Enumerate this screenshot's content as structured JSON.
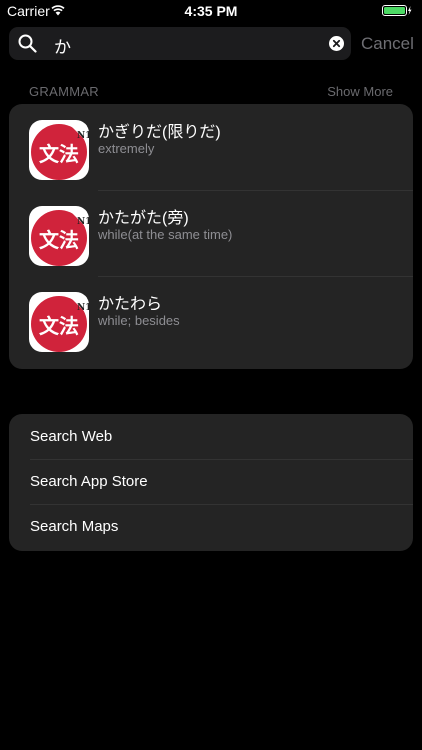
{
  "status_bar": {
    "carrier": "Carrier",
    "time": "4:35 PM"
  },
  "search": {
    "query": "か",
    "cancel_label": "Cancel"
  },
  "section": {
    "title": "GRAMMAR",
    "show_more_label": "Show More"
  },
  "app_icon": {
    "kanji": "文法",
    "level": "N1",
    "color": "#d0233b"
  },
  "results": [
    {
      "title": "かぎりだ(限りだ)",
      "subtitle": "extremely"
    },
    {
      "title": "かたがた(旁)",
      "subtitle": "while(at the same time)"
    },
    {
      "title": "かたわら",
      "subtitle": "while; besides"
    }
  ],
  "actions": [
    {
      "label": "Search Web"
    },
    {
      "label": "Search App Store"
    },
    {
      "label": "Search Maps"
    }
  ],
  "colors": {
    "background": "#000000",
    "card": "#242424",
    "battery": "#4cd964",
    "secondary_text": "#8e8e93"
  }
}
